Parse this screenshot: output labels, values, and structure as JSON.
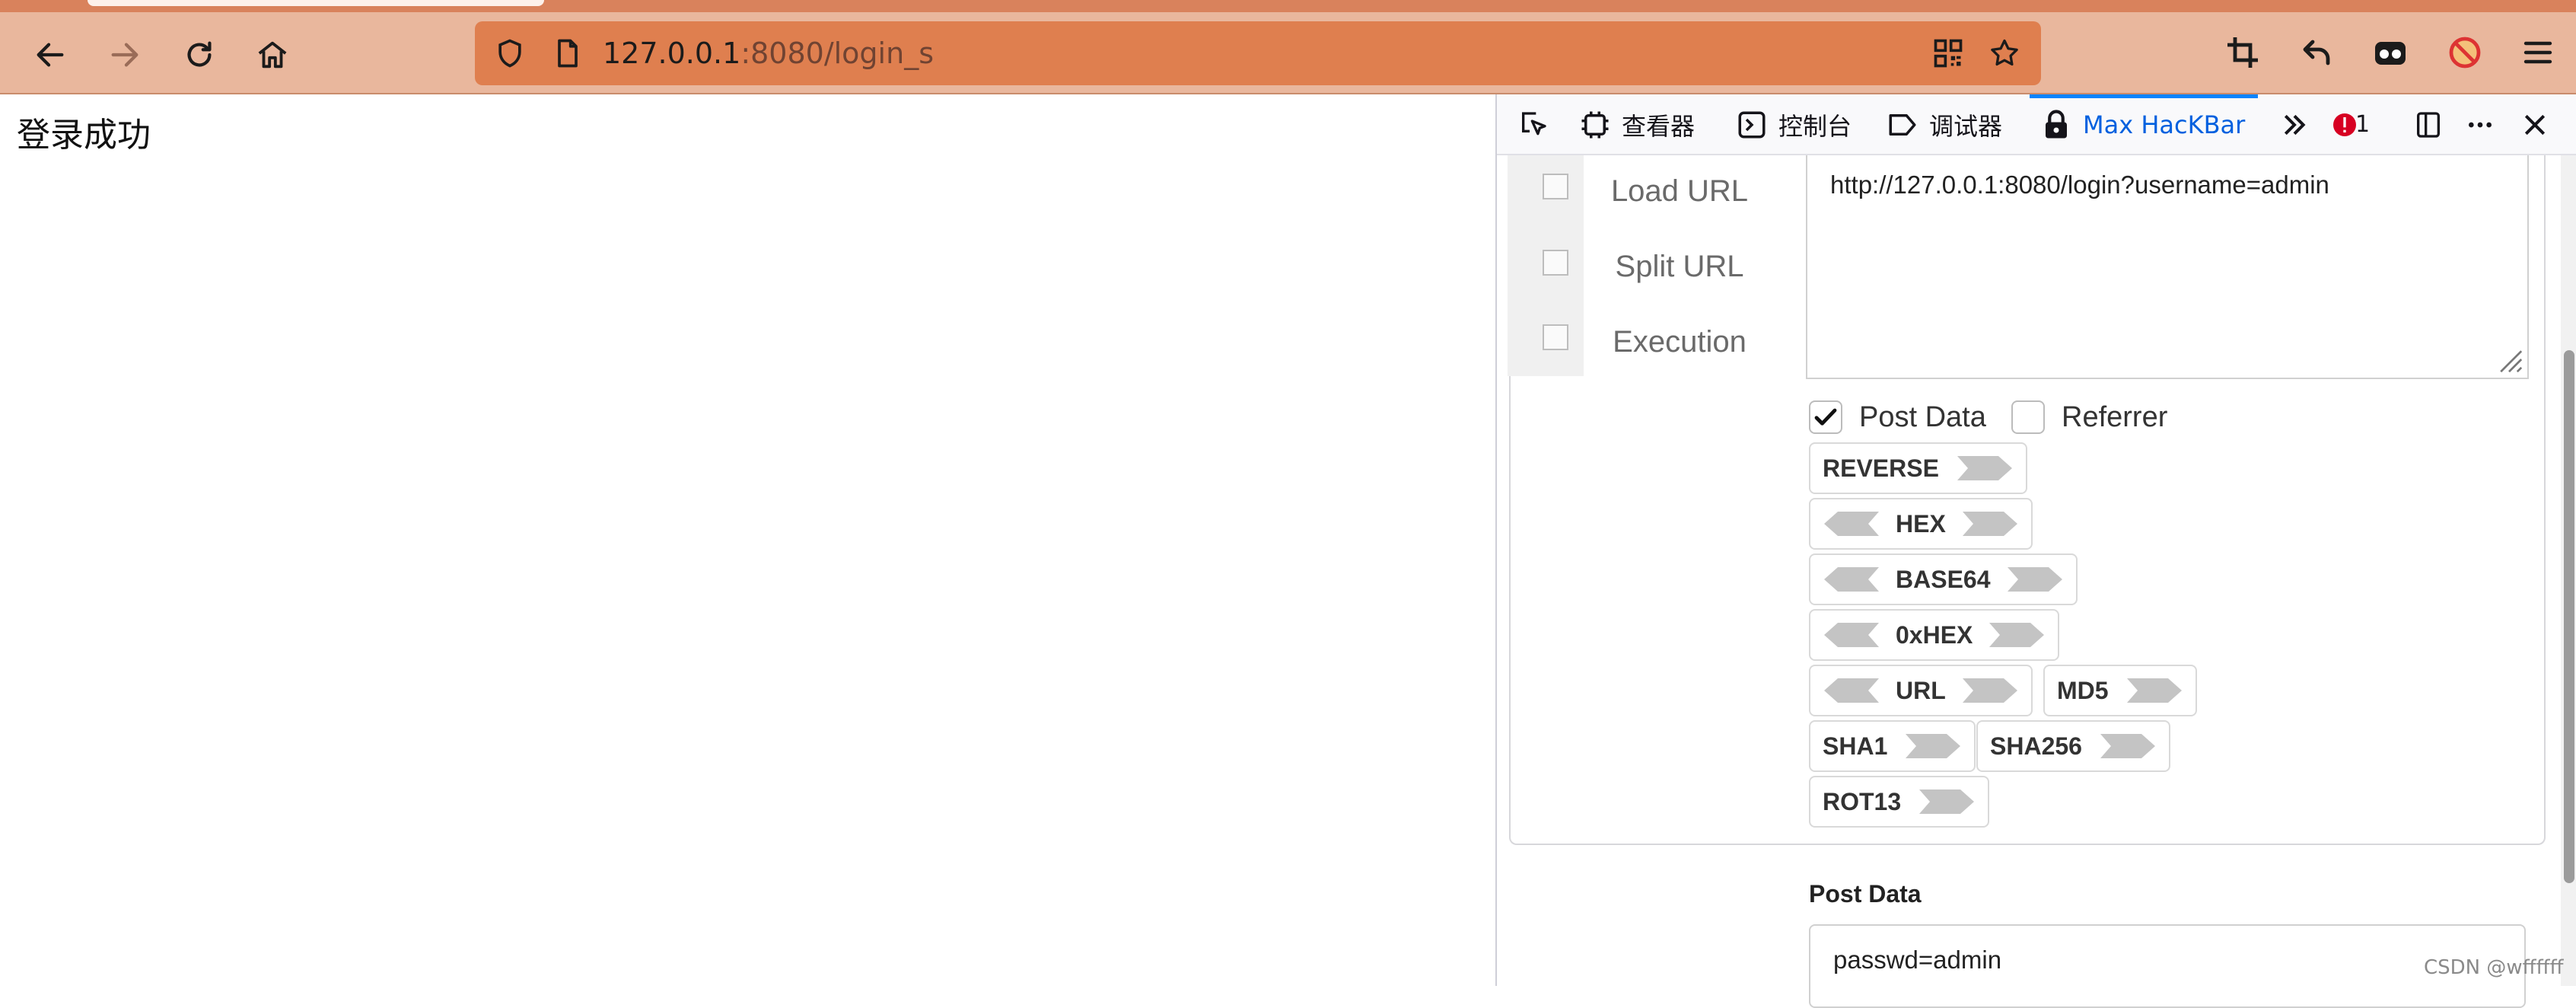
{
  "browser": {
    "url_host": "127.0.0.1",
    "url_rest": ":8080/login_s",
    "icons": [
      "back-icon",
      "forward-icon",
      "reload-icon",
      "home-icon",
      "shield-icon",
      "page-icon",
      "qrcode-icon",
      "bookmark-star-icon",
      "crop-icon",
      "undo-icon",
      "extension-mask-icon",
      "blocked-icon",
      "menu-icon"
    ],
    "accent_color": "#df7f4f"
  },
  "page": {
    "text": "登录成功"
  },
  "devtools": {
    "tabs": [
      {
        "label": "查看器"
      },
      {
        "label": "控制台"
      },
      {
        "label": "调试器"
      },
      {
        "label": "Max HacKBar"
      }
    ],
    "error_count": "1"
  },
  "hackbar": {
    "actions": [
      "Load URL",
      "Split URL",
      "Execution"
    ],
    "url_value": "http://127.0.0.1:8080/login?username=admin",
    "post_data_checkbox": {
      "label": "Post Data",
      "checked": true
    },
    "referrer_checkbox": {
      "label": "Referrer",
      "checked": false
    },
    "encoders": {
      "reverse": "REVERSE",
      "hex": "HEX",
      "base64": "BASE64",
      "oxhex": "0xHEX",
      "url": "URL",
      "md5": "MD5",
      "sha1": "SHA1",
      "sha256": "SHA256",
      "rot13": "ROT13"
    },
    "post_data_label": "Post Data",
    "post_data_value": "passwd=admin"
  },
  "watermark": "CSDN @wffffff"
}
